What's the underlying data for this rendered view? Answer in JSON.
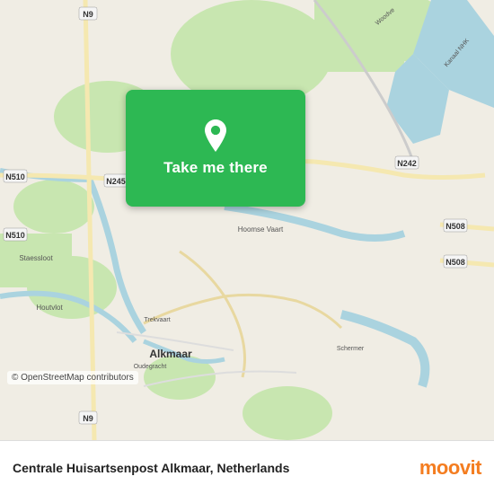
{
  "map": {
    "osm_credit": "© OpenStreetMap contributors"
  },
  "overlay": {
    "button_label": "Take me there",
    "pin_icon": "location-pin"
  },
  "footer": {
    "title": "Centrale Huisartsenpost Alkmaar, Netherlands",
    "logo": "moovit"
  }
}
